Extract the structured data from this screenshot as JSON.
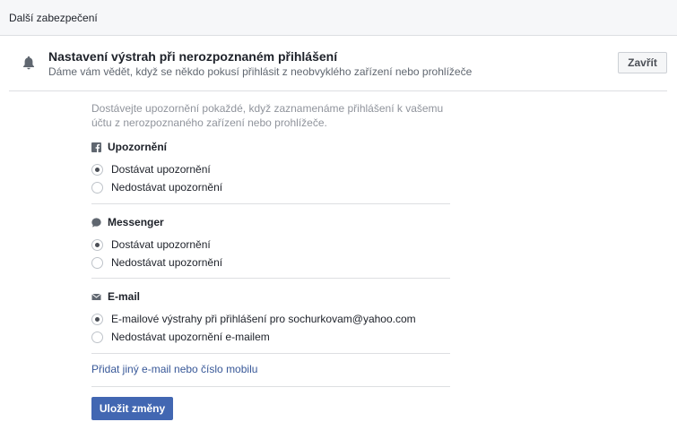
{
  "header": {
    "title": "Další zabezpečení"
  },
  "panel": {
    "title": "Nastavení výstrah při nerozpoznaném přihlášení",
    "subtitle": "Dáme vám vědět, když se někdo pokusí přihlásit z neobvyklého zařízení nebo prohlížeče",
    "close_label": "Zavřít",
    "intro": "Dostávejte upozornění pokaždé, když zaznamenáme přihlášení k vašemu účtu z nerozpoznaného zařízení nebo prohlížeče.",
    "sections": [
      {
        "label": "Upozornění",
        "icon": "facebook-icon",
        "options": [
          {
            "label": "Dostávat upozornění",
            "checked": true
          },
          {
            "label": "Nedostávat upozornění",
            "checked": false
          }
        ]
      },
      {
        "label": "Messenger",
        "icon": "messenger-icon",
        "options": [
          {
            "label": "Dostávat upozornění",
            "checked": true
          },
          {
            "label": "Nedostávat upozornění",
            "checked": false
          }
        ]
      },
      {
        "label": "E-mail",
        "icon": "envelope-icon",
        "options": [
          {
            "label": "E-mailové výstrahy při přihlášení pro sochurkovam@yahoo.com",
            "checked": true
          },
          {
            "label": "Nedostávat upozornění e-mailem",
            "checked": false
          }
        ]
      }
    ],
    "add_contact_link": "Přidat jiný e-mail nebo číslo mobilu",
    "save_label": "Uložit změny"
  },
  "colors": {
    "primary_button": "#4267b2",
    "link": "#385898",
    "border": "#dddfe2",
    "muted_text": "#90949c"
  }
}
